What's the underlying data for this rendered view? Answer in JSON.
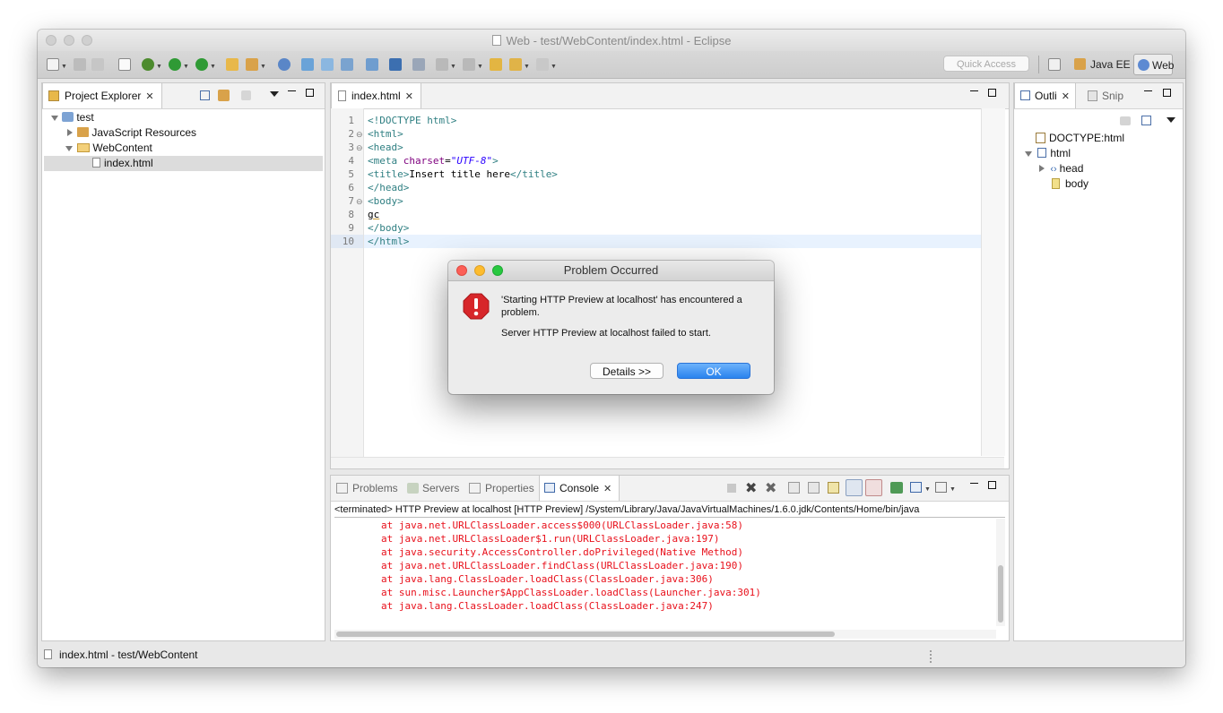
{
  "window": {
    "title": "Web - test/WebContent/index.html - Eclipse"
  },
  "toolbar": {
    "quick_access_placeholder": "Quick Access"
  },
  "perspectives": [
    {
      "label": "Java EE"
    },
    {
      "label": "Web"
    }
  ],
  "project_explorer": {
    "tab_label": "Project Explorer",
    "tree": [
      {
        "label": "test"
      },
      {
        "label": "JavaScript Resources"
      },
      {
        "label": "WebContent"
      },
      {
        "label": "index.html"
      }
    ]
  },
  "editor": {
    "tab_label": "index.html",
    "line_numbers": [
      "1",
      "2",
      "3",
      "4",
      "5",
      "6",
      "7",
      "8",
      "9",
      "10"
    ],
    "lines": [
      {
        "tag": "<!DOCTYPE html>"
      },
      {
        "tag": "<html>"
      },
      {
        "tag": "<head>"
      },
      {
        "pre": "<meta ",
        "attr": "charset",
        "eq": "=",
        "val": "\"UTF-8\"",
        "post": ">"
      },
      {
        "tag1": "<title>",
        "text": "Insert title here",
        "tag2": "</title>"
      },
      {
        "tag": "</head>"
      },
      {
        "tag": "<body>"
      },
      {
        "text": "gc"
      },
      {
        "tag": "</body>"
      },
      {
        "tag": "</html>"
      }
    ]
  },
  "outline": {
    "tabs": [
      {
        "label": "Outli"
      },
      {
        "label": "Snip"
      }
    ],
    "tree": [
      {
        "label": "DOCTYPE:html"
      },
      {
        "label": "html"
      },
      {
        "label": "head"
      },
      {
        "label": "body"
      }
    ]
  },
  "bottom_panel": {
    "tabs": [
      {
        "label": "Problems"
      },
      {
        "label": "Servers"
      },
      {
        "label": "Properties"
      },
      {
        "label": "Console"
      }
    ],
    "console_header": "<terminated> HTTP Preview at localhost [HTTP Preview] /System/Library/Java/JavaVirtualMachines/1.6.0.jdk/Contents/Home/bin/java",
    "console_lines": [
      "at java.net.URLClassLoader.access$000(URLClassLoader.java:58)",
      "at java.net.URLClassLoader$1.run(URLClassLoader.java:197)",
      "at java.security.AccessController.doPrivileged(Native Method)",
      "at java.net.URLClassLoader.findClass(URLClassLoader.java:190)",
      "at java.lang.ClassLoader.loadClass(ClassLoader.java:306)",
      "at sun.misc.Launcher$AppClassLoader.loadClass(Launcher.java:301)",
      "at java.lang.ClassLoader.loadClass(ClassLoader.java:247)"
    ]
  },
  "dialog": {
    "title": "Problem Occurred",
    "message": "'Starting HTTP Preview at localhost' has encountered a problem.",
    "detail": "Server HTTP Preview at localhost failed to start.",
    "details_button": "Details >>",
    "ok_button": "OK"
  },
  "status_bar": {
    "text": "index.html - test/WebContent"
  },
  "colors": {
    "accent": "#3d89f5",
    "console_error": "#e8101b",
    "tag": "#2f7f82"
  }
}
